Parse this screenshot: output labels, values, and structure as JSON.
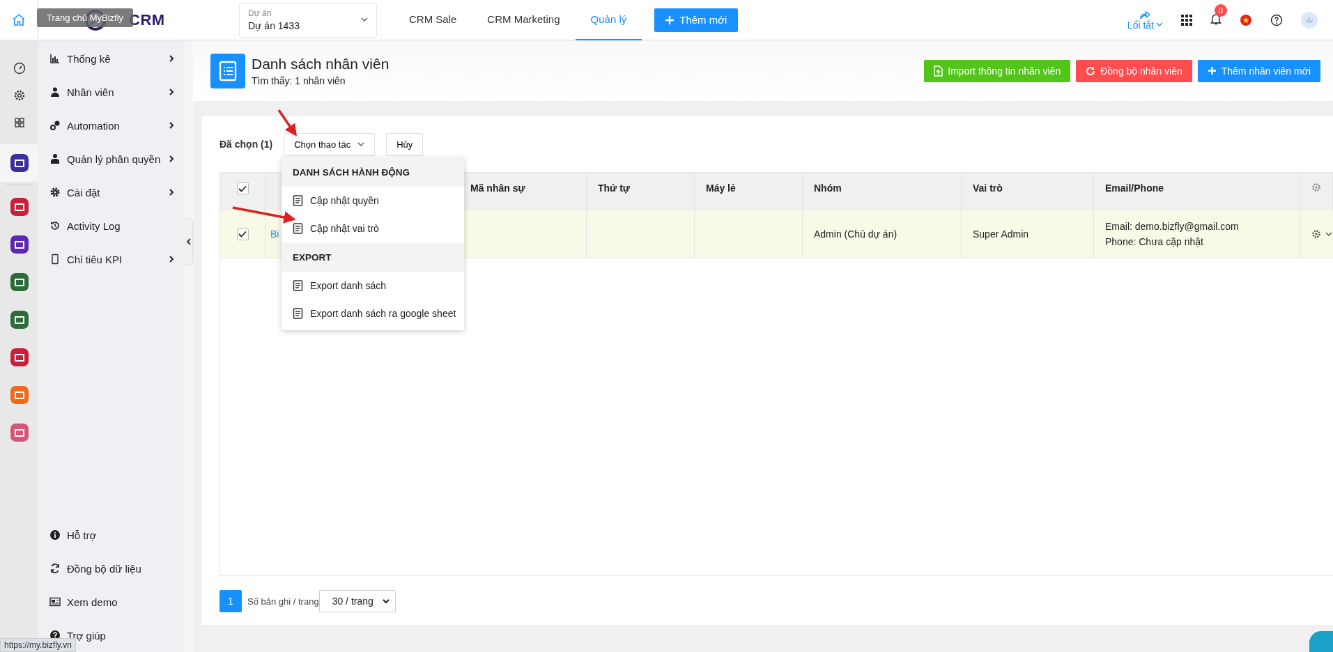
{
  "header": {
    "tooltip": "Trang chủ MyBizfly",
    "logo": "CRM",
    "project": {
      "label": "Dự án",
      "value": "Dự án 1433"
    },
    "tabs": [
      {
        "label": "CRM Sale",
        "selected": false
      },
      {
        "label": "CRM Marketing",
        "selected": false
      },
      {
        "label": "Quản lý",
        "selected": true
      }
    ],
    "add_button": "Thêm mới",
    "shortcut": "Lối tắt",
    "notifications": "0"
  },
  "rail": {
    "tools": [
      {
        "kind": "gauge"
      },
      {
        "kind": "gear"
      },
      {
        "kind": "grid"
      }
    ],
    "apps": [
      {
        "color": "#3b2f9e",
        "selected": true
      },
      {
        "color": "#c8203a",
        "selected": false
      },
      {
        "color": "#5b2ab0",
        "selected": false
      },
      {
        "color": "#2e6b3a",
        "selected": false
      },
      {
        "color": "#2e6b3a",
        "selected": false
      },
      {
        "color": "#c8203a",
        "selected": false
      },
      {
        "color": "#f06a18",
        "selected": false
      },
      {
        "color": "#d6567a",
        "selected": false
      }
    ]
  },
  "sidebar": {
    "items": [
      {
        "kind": "chart",
        "label": "Thống kê",
        "has_children": true
      },
      {
        "kind": "person",
        "label": "Nhân viên",
        "has_children": true
      },
      {
        "kind": "gears",
        "label": "Automation",
        "has_children": true
      },
      {
        "kind": "manager",
        "label": "Quản lý phân quyền",
        "has_children": true
      },
      {
        "kind": "gear",
        "label": "Cài đặt",
        "has_children": true
      },
      {
        "kind": "history",
        "label": "Activity Log",
        "has_children": false
      },
      {
        "kind": "phone",
        "label": "Chỉ tiêu KPI",
        "has_children": true
      }
    ],
    "bottom_items": [
      {
        "kind": "info",
        "label": "Hỗ trợ"
      },
      {
        "kind": "sync",
        "label": "Đồng bộ dữ liệu"
      },
      {
        "kind": "demo",
        "label": "Xem demo"
      },
      {
        "kind": "help",
        "label": "Trợ giúp"
      }
    ]
  },
  "page": {
    "title": "Danh sách nhân viên",
    "subtitle": "Tìm thấy: 1 nhân viên",
    "buttons": [
      {
        "kind": "import",
        "label": "Import thông tin nhân viên"
      },
      {
        "kind": "sync",
        "label": "Đồng bộ nhân viên"
      },
      {
        "kind": "add",
        "label": "Thêm nhân viên mới"
      }
    ]
  },
  "toolbar": {
    "selected_count": "Đã chọn (1)",
    "action": "Chọn thao tác",
    "cancel": "Hủy"
  },
  "menu": {
    "sections": [
      {
        "title": "DANH SÁCH HÀNH ĐỘNG",
        "items": [
          "Cập nhật quyền",
          "Cập nhật vai trò"
        ]
      },
      {
        "title": "EXPORT",
        "items": [
          "Export danh sách",
          "Export danh sách ra google sheet"
        ]
      }
    ]
  },
  "table": {
    "all_checked": true,
    "columns": [
      "",
      "Mã nhân sự",
      "Thứ tự",
      "Máy lẻ",
      "Nhóm",
      "Vai trò",
      "Email/Phone"
    ],
    "rows": [
      {
        "checked": true,
        "name": "Bi",
        "code": "",
        "order": "",
        "ext": "",
        "group": "Admin (Chủ dự án)",
        "role": "Super Admin",
        "contact": [
          "Email: demo.bizfly@gmail.com",
          "Phone: Chưa cập nhật"
        ]
      }
    ]
  },
  "pagination": {
    "pages": [
      {
        "label": "1",
        "selected": true
      }
    ],
    "per_page_label": "Số bản ghi / trang",
    "per_page": "30 / trang"
  },
  "status_url": "https://my.bizfly.vn"
}
